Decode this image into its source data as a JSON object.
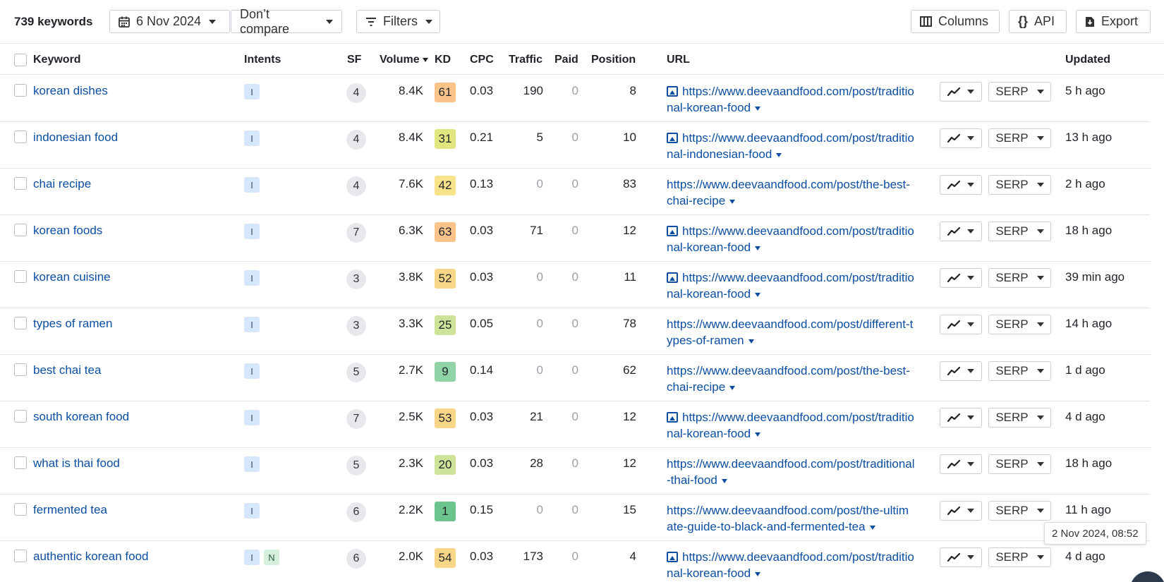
{
  "toolbar": {
    "keyword_count": "739 keywords",
    "date_label": "6 Nov 2024",
    "compare_label": "Don’t compare",
    "filters_label": "Filters",
    "columns_label": "Columns",
    "api_label": "API",
    "export_label": "Export"
  },
  "table": {
    "headers": {
      "keyword": "Keyword",
      "intents": "Intents",
      "sf": "SF",
      "volume": "Volume",
      "kd": "KD",
      "cpc": "CPC",
      "traffic": "Traffic",
      "paid": "Paid",
      "position": "Position",
      "url": "URL",
      "updated": "Updated"
    },
    "serp_label": "SERP",
    "rows": [
      {
        "keyword": "korean dishes",
        "intents": [
          "I"
        ],
        "sf": "4",
        "volume": "8.4K",
        "kd": "61",
        "kd_color": "#f9c38a",
        "cpc": "0.03",
        "traffic": "190",
        "paid": "0",
        "position": "8",
        "url": "https://www.deevaandfood.com/post/traditional-korean-food",
        "url_image": true,
        "updated": "5 h ago"
      },
      {
        "keyword": "indonesian food",
        "intents": [
          "I"
        ],
        "sf": "4",
        "volume": "8.4K",
        "kd": "31",
        "kd_color": "#e2e67f",
        "cpc": "0.21",
        "traffic": "5",
        "paid": "0",
        "position": "10",
        "url": "https://www.deevaandfood.com/post/traditional-indonesian-food",
        "url_image": true,
        "updated": "13 h ago"
      },
      {
        "keyword": "chai recipe",
        "intents": [
          "I"
        ],
        "sf": "4",
        "volume": "7.6K",
        "kd": "42",
        "kd_color": "#f8e28a",
        "cpc": "0.13",
        "traffic": "0",
        "paid": "0",
        "position": "83",
        "url": "https://www.deevaandfood.com/post/the-best-chai-recipe",
        "url_image": false,
        "updated": "2 h ago"
      },
      {
        "keyword": "korean foods",
        "intents": [
          "I"
        ],
        "sf": "7",
        "volume": "6.3K",
        "kd": "63",
        "kd_color": "#f9c38a",
        "cpc": "0.03",
        "traffic": "71",
        "paid": "0",
        "position": "12",
        "url": "https://www.deevaandfood.com/post/traditional-korean-food",
        "url_image": true,
        "updated": "18 h ago"
      },
      {
        "keyword": "korean cuisine",
        "intents": [
          "I"
        ],
        "sf": "3",
        "volume": "3.8K",
        "kd": "52",
        "kd_color": "#f8d688",
        "cpc": "0.03",
        "traffic": "0",
        "paid": "0",
        "position": "11",
        "url": "https://www.deevaandfood.com/post/traditional-korean-food",
        "url_image": true,
        "updated": "39 min ago"
      },
      {
        "keyword": "types of ramen",
        "intents": [
          "I"
        ],
        "sf": "3",
        "volume": "3.3K",
        "kd": "25",
        "kd_color": "#cfe29a",
        "cpc": "0.05",
        "traffic": "0",
        "paid": "0",
        "position": "78",
        "url": "https://www.deevaandfood.com/post/different-types-of-ramen",
        "url_image": false,
        "updated": "14 h ago"
      },
      {
        "keyword": "best chai tea",
        "intents": [
          "I"
        ],
        "sf": "5",
        "volume": "2.7K",
        "kd": "9",
        "kd_color": "#8fd3a6",
        "cpc": "0.14",
        "traffic": "0",
        "paid": "0",
        "position": "62",
        "url": "https://www.deevaandfood.com/post/the-best-chai-recipe",
        "url_image": false,
        "updated": "1 d ago"
      },
      {
        "keyword": "south korean food",
        "intents": [
          "I"
        ],
        "sf": "7",
        "volume": "2.5K",
        "kd": "53",
        "kd_color": "#f8d688",
        "cpc": "0.03",
        "traffic": "21",
        "paid": "0",
        "position": "12",
        "url": "https://www.deevaandfood.com/post/traditional-korean-food",
        "url_image": true,
        "updated": "4 d ago"
      },
      {
        "keyword": "what is thai food",
        "intents": [
          "I"
        ],
        "sf": "5",
        "volume": "2.3K",
        "kd": "20",
        "kd_color": "#cfe29a",
        "cpc": "0.03",
        "traffic": "28",
        "paid": "0",
        "position": "12",
        "url": "https://www.deevaandfood.com/post/traditional-thai-food",
        "url_image": false,
        "updated": "18 h ago"
      },
      {
        "keyword": "fermented tea",
        "intents": [
          "I"
        ],
        "sf": "6",
        "volume": "2.2K",
        "kd": "1",
        "kd_color": "#6cc38c",
        "cpc": "0.15",
        "traffic": "0",
        "paid": "0",
        "position": "15",
        "url": "https://www.deevaandfood.com/post/the-ultimate-guide-to-black-and-fermented-tea",
        "url_image": false,
        "updated": "11 h ago"
      },
      {
        "keyword": "authentic korean food",
        "intents": [
          "I",
          "N"
        ],
        "sf": "6",
        "volume": "2.0K",
        "kd": "54",
        "kd_color": "#f8d688",
        "cpc": "0.03",
        "traffic": "173",
        "paid": "0",
        "position": "4",
        "url": "https://www.deevaandfood.com/post/traditional-korean-food",
        "url_image": true,
        "updated": "4 d ago"
      }
    ]
  },
  "tooltip": {
    "text": "2 Nov 2024, 08:52"
  }
}
